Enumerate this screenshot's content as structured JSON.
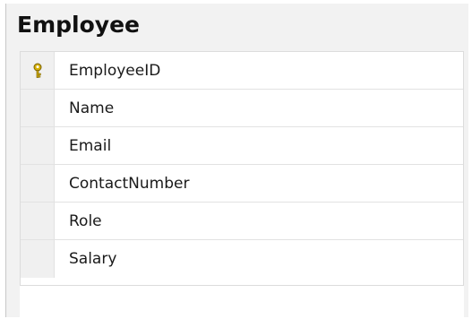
{
  "table": {
    "title": "Employee",
    "columns": [
      {
        "label": "EmployeeID",
        "primary_key": true,
        "icon": "primary-key-icon"
      },
      {
        "label": "Name",
        "primary_key": false
      },
      {
        "label": "Email",
        "primary_key": false
      },
      {
        "label": "ContactNumber",
        "primary_key": false
      },
      {
        "label": "Role",
        "primary_key": false
      },
      {
        "label": "Salary",
        "primary_key": false
      }
    ]
  },
  "colors": {
    "key_icon": "#d6b000",
    "background": "#f2f2f2",
    "grid_background": "#ffffff"
  }
}
